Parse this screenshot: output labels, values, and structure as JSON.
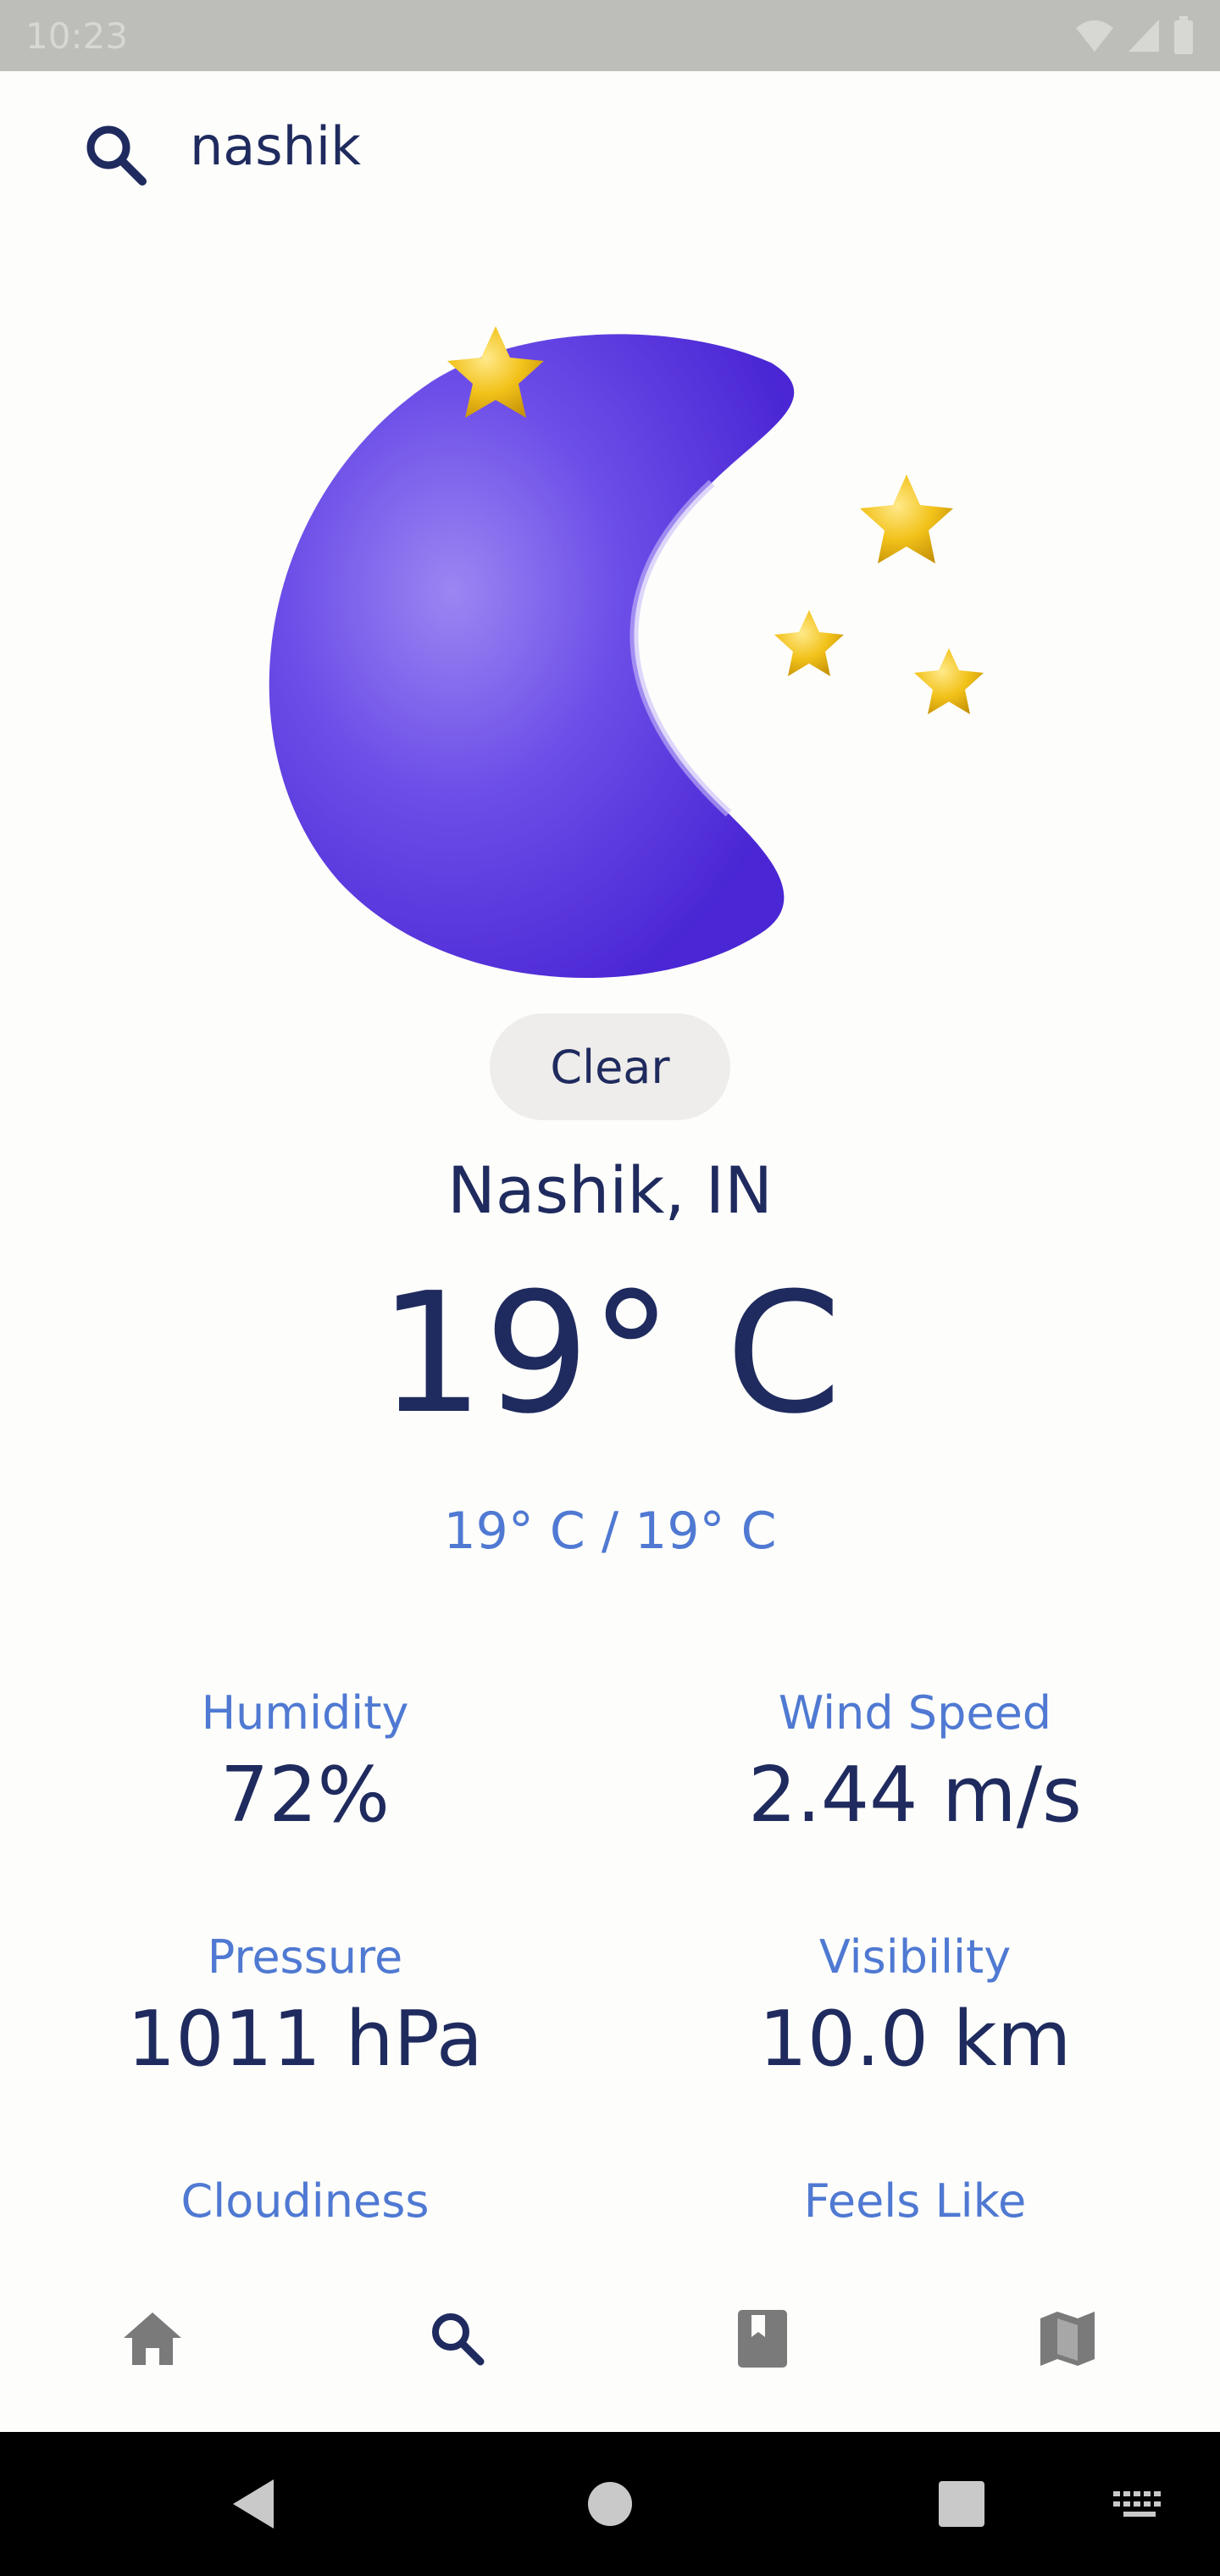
{
  "status_bar": {
    "time": "10:23"
  },
  "search": {
    "value": "nashik"
  },
  "weather": {
    "condition": "Clear",
    "location": "Nashik, IN",
    "temperature": "19° C",
    "min_max": "19° C / 19° C"
  },
  "metrics": {
    "humidity": {
      "label": "Humidity",
      "value": "72%"
    },
    "wind_speed": {
      "label": "Wind Speed",
      "value": "2.44 m/s"
    },
    "pressure": {
      "label": "Pressure",
      "value": "1011 hPa"
    },
    "visibility": {
      "label": "Visibility",
      "value": "10.0 km"
    },
    "cloudiness": {
      "label": "Cloudiness"
    },
    "feels_like": {
      "label": "Feels Like"
    }
  },
  "colors": {
    "primary_text": "#1f2b5e",
    "accent_text": "#4f79d2",
    "moon": "#6a48e6",
    "star": "#f2c21a"
  },
  "icons": {
    "search": "search-icon",
    "weather_art": "crescent-moon-with-stars",
    "nav": [
      "home-icon",
      "search-icon",
      "book-icon",
      "map-icon"
    ]
  }
}
